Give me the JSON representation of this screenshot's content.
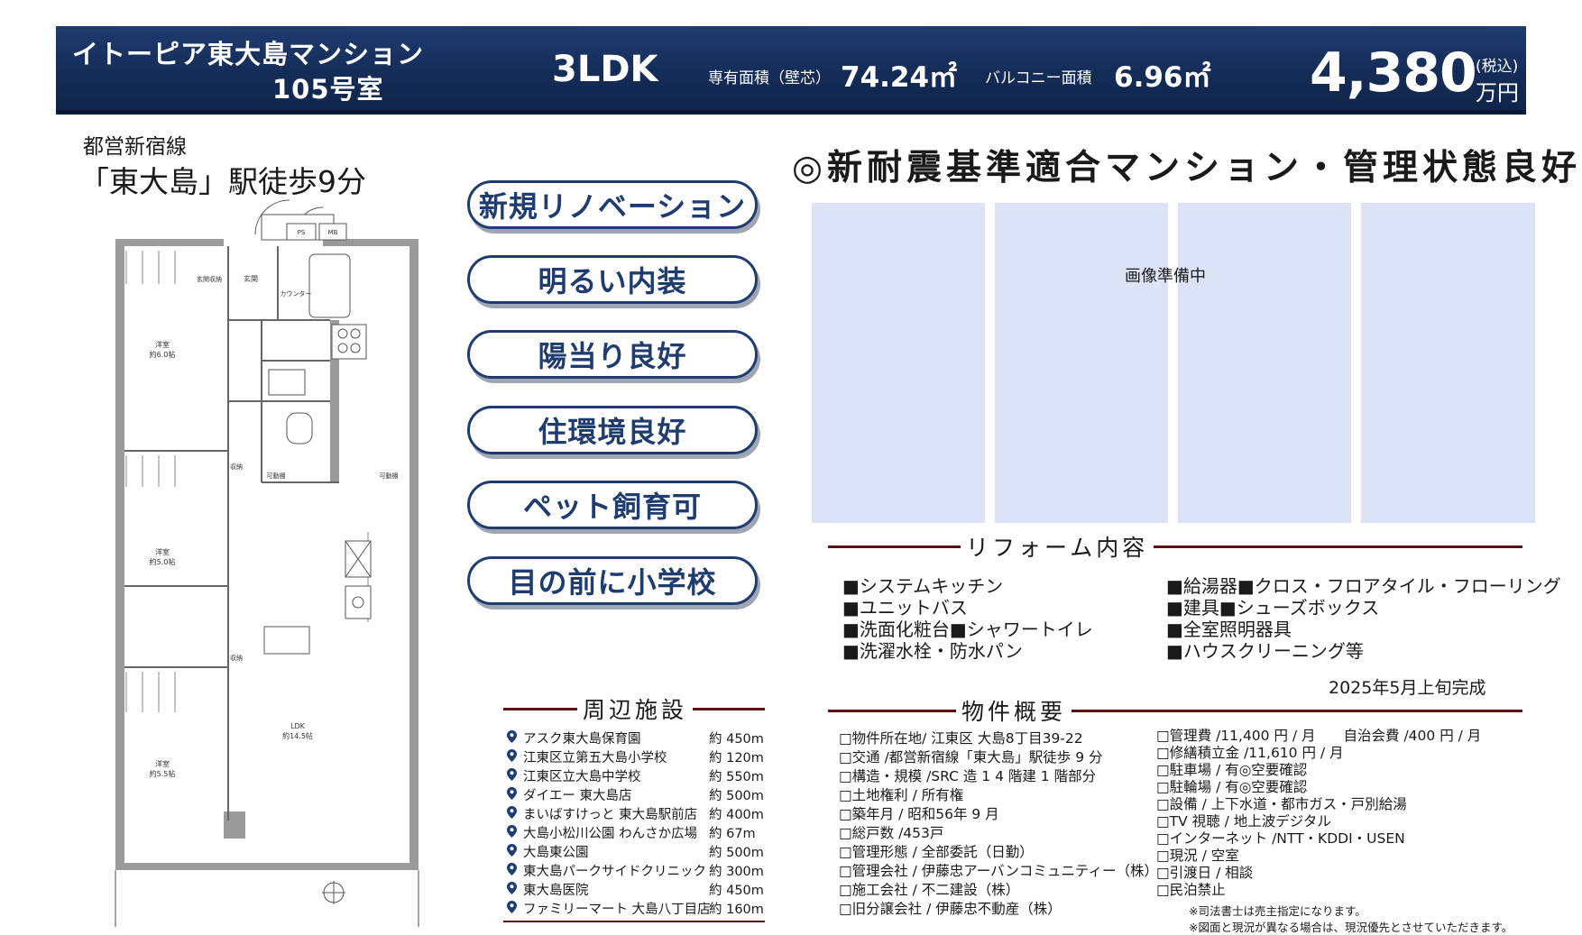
{
  "header": {
    "building_name": "イトーピア東大島マンション",
    "room_number": "105号室",
    "layout": "3LDK",
    "area_label": "専有面積（壁芯）",
    "area_value": "74.24㎡",
    "balcony_label": "バルコニー面積",
    "balcony_value": "6.96㎡",
    "price": "4,380",
    "price_tax": "(税込)",
    "price_unit": "万円",
    "colors": {
      "navy": "#1f3c70",
      "accent_rule": "#5a1212",
      "photo_placeholder": "#dce3f6"
    }
  },
  "access": {
    "line": "都営新宿線",
    "station": "「東大島」駅徒歩9分"
  },
  "floorplan": {
    "labels": {
      "room1": "洋室",
      "room1_size": "約6.0帖",
      "room2": "洋室",
      "room2_size": "約5.0帖",
      "room3": "洋室",
      "room3_size": "約5.5帖",
      "ldk": "LDK",
      "ldk_size": "約14.5帖",
      "entrance": "玄関",
      "entrance_storage": "玄関収納",
      "counter": "カウンター",
      "storage1": "収納",
      "storage2": "収納",
      "movable_shelf1": "可動棚",
      "movable_shelf2": "可動棚",
      "ps": "PS",
      "mb": "MB"
    }
  },
  "features": [
    {
      "label": "新規リノベーション"
    },
    {
      "label": "明るい内装"
    },
    {
      "label": "陽当り良好"
    },
    {
      "label": "住環境良好"
    },
    {
      "label": "ペット飼育可"
    },
    {
      "label": "目の前に小学校"
    }
  ],
  "headline": "◎新耐震基準適合マンション・管理状態良好◎",
  "photos": {
    "note": "画像準備中"
  },
  "reform": {
    "title": "リフォーム内容",
    "left_items": [
      "■システムキッチン",
      "■ユニットバス",
      "■洗面化粧台■シャワートイレ",
      "■洗濯水栓・防水パン"
    ],
    "right_items": [
      "■給湯器■クロス・フロアタイル・フローリング",
      "■建具■シューズボックス",
      "■全室照明器具",
      "■ハウスクリーニング等"
    ],
    "completion": "2025年5月上旬完成"
  },
  "facilities": {
    "title": "周辺施設",
    "items": [
      {
        "name": "アスク東大島保育園",
        "distance": "約 450m"
      },
      {
        "name": "江東区立第五大島小学校",
        "distance": "約 120m"
      },
      {
        "name": "江東区立大島中学校",
        "distance": "約 550m"
      },
      {
        "name": "ダイエー 東大島店",
        "distance": "約 500m"
      },
      {
        "name": "まいばすけっと 東大島駅前店",
        "distance": "約 400m"
      },
      {
        "name": "大島小松川公園 わんさか広場",
        "distance": "約 67m"
      },
      {
        "name": "大島東公園",
        "distance": "約 500m"
      },
      {
        "name": "東大島パークサイドクリニック",
        "distance": "約 300m"
      },
      {
        "name": "東大島医院",
        "distance": "約 450m"
      },
      {
        "name": "ファミリーマート 大島八丁目店",
        "distance": "約 160m"
      }
    ],
    "pin_color": "#1f3c70"
  },
  "overview": {
    "title": "物件概要",
    "left_items": [
      "□物件所在地/ 江東区 大島8丁目39-22",
      "□交通 /都営新宿線「東大島」駅徒歩 9 分",
      "□構造・規模 /SRC 造 1 4 階建 1 階部分",
      "□土地権利 / 所有権",
      "□築年月 / 昭和56年 9 月",
      "□総戸数 /453戸",
      "□管理形態 / 全部委託（日勤）",
      "□管理会社 / 伊藤忠アーバンコミュニティー（株）",
      "□施工会社 / 不二建設（株）",
      "□旧分譲会社 / 伊藤忠不動産（株）"
    ],
    "right_items": [
      "□管理費 /11,400 円 / 月　　自治会費 /400 円 / 月",
      "□修繕積立金 /11,610 円 / 月",
      "□駐車場 / 有◎空要確認",
      "□駐輪場 / 有◎空要確認",
      "□設備 / 上下水道・都市ガス・戸別給湯",
      "□TV 視聴 / 地上波デジタル",
      "□インターネット /NTT・KDDI・USEN",
      "□現況 / 空室",
      "□引渡日 / 相談",
      "□民泊禁止"
    ],
    "notes": [
      "※司法書士は売主指定になります。",
      "※図面と現況が異なる場合は、現況優先とさせていただきます。"
    ]
  }
}
